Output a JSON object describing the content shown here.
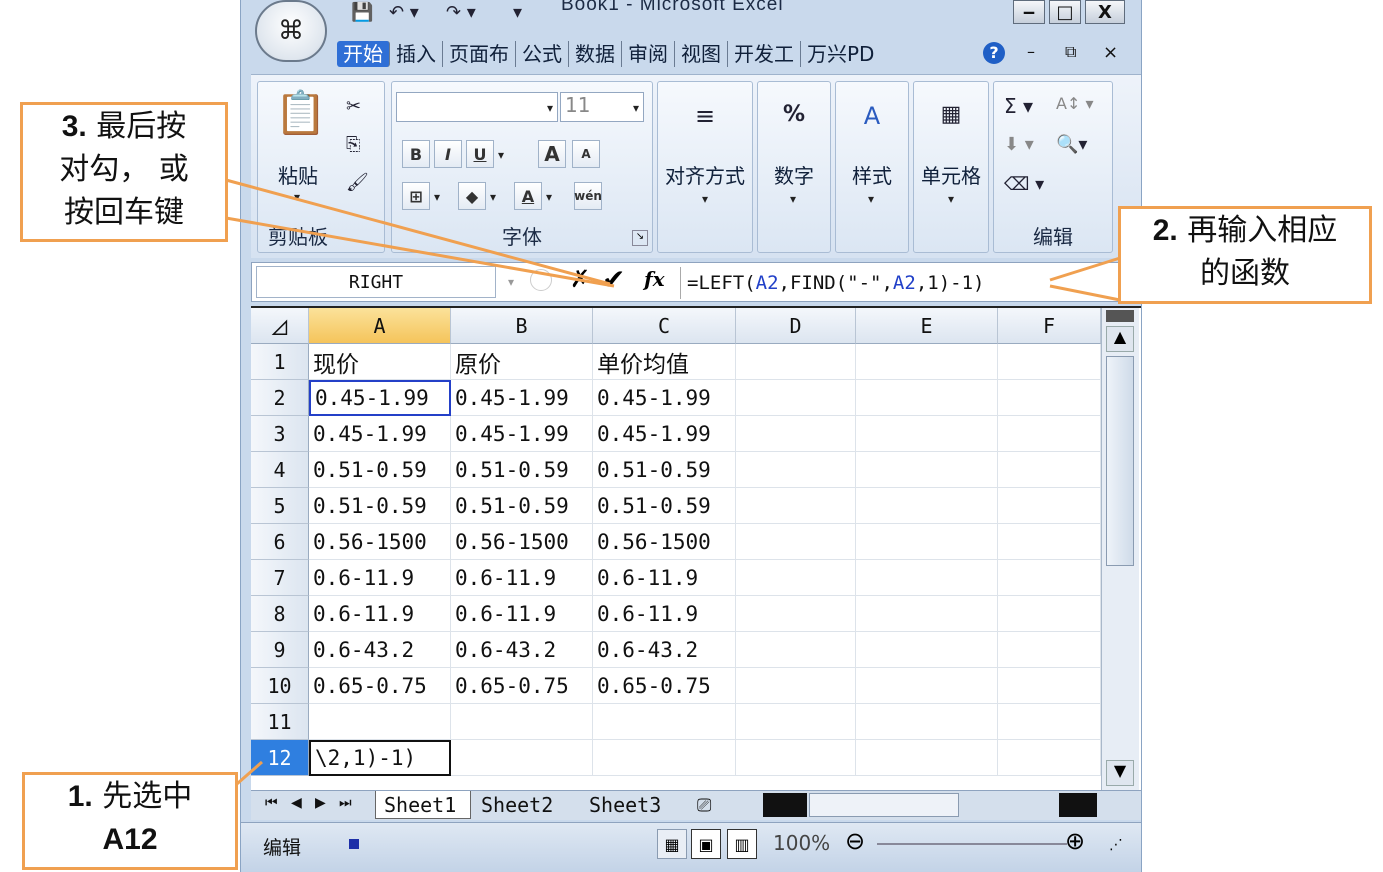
{
  "window": {
    "title": "Book1 - Microsoft Excel",
    "office_button_icon": "office-logo-icon",
    "minimize": "‒",
    "maximize": "□",
    "close": "X"
  },
  "ribbon_tabs": [
    "开始",
    "插入",
    "页面布",
    "公式",
    "数据",
    "审阅",
    "视图",
    "开发工",
    "万兴PD"
  ],
  "ribbon_controls": {
    "help": "?",
    "minimize": "–",
    "restore": "⧉",
    "close": "×"
  },
  "ribbon": {
    "clipboard": {
      "paste_label": "粘贴",
      "group_label": "剪贴板"
    },
    "font": {
      "font_name": "",
      "font_size": "11",
      "group_label": "字体"
    },
    "alignment_label": "对齐方式",
    "number_label": "数字",
    "styles_label": "样式",
    "cells_label": "单元格",
    "editing": {
      "group_label": "编辑"
    }
  },
  "formula_bar": {
    "name_box": "RIGHT",
    "formula_parts": [
      "=LEFT(",
      "A2",
      ",FIND(\"-\",",
      "A2",
      ",1)-1)"
    ]
  },
  "columns": [
    "A",
    "B",
    "C",
    "D",
    "E",
    "F"
  ],
  "selected_column": "A",
  "rows": [
    {
      "num": "1",
      "cells": [
        "现价",
        "原价",
        "单价均值"
      ]
    },
    {
      "num": "2",
      "cells": [
        "0.45-1.99",
        "0.45-1.99",
        "0.45-1.99"
      ]
    },
    {
      "num": "3",
      "cells": [
        "0.45-1.99",
        "0.45-1.99",
        "0.45-1.99"
      ]
    },
    {
      "num": "4",
      "cells": [
        "0.51-0.59",
        "0.51-0.59",
        "0.51-0.59"
      ]
    },
    {
      "num": "5",
      "cells": [
        "0.51-0.59",
        "0.51-0.59",
        "0.51-0.59"
      ]
    },
    {
      "num": "6",
      "cells": [
        "0.56-1500",
        "0.56-1500",
        "0.56-1500"
      ]
    },
    {
      "num": "7",
      "cells": [
        "0.6-11.9",
        "0.6-11.9",
        "0.6-11.9"
      ]
    },
    {
      "num": "8",
      "cells": [
        "0.6-11.9",
        "0.6-11.9",
        "0.6-11.9"
      ]
    },
    {
      "num": "9",
      "cells": [
        "0.6-43.2",
        "0.6-43.2",
        "0.6-43.2"
      ]
    },
    {
      "num": "10",
      "cells": [
        "0.65-0.75",
        "0.65-0.75",
        "0.65-0.75"
      ]
    },
    {
      "num": "11",
      "cells": [
        "",
        "",
        ""
      ]
    },
    {
      "num": "12",
      "cells": [
        "\\2,1)-1)",
        "",
        ""
      ]
    }
  ],
  "selected_row": "12",
  "sheet_tabs": [
    "Sheet1",
    "Sheet2",
    "Sheet3"
  ],
  "status": {
    "mode": "编辑",
    "zoom": "100%"
  },
  "callouts": {
    "step1": {
      "num": "1.",
      "text": "先选中",
      "ref": "A12"
    },
    "step2": {
      "num": "2.",
      "text": "再输入相应",
      "text2": "的函数"
    },
    "step3": {
      "num": "3.",
      "text": "最后按",
      "text2": "对勾， 或",
      "text3": "按回车键"
    }
  },
  "colors": {
    "callout_border": "#f0a050",
    "selection": "#2f7fe0",
    "tab_active": "#2f6fd6"
  }
}
